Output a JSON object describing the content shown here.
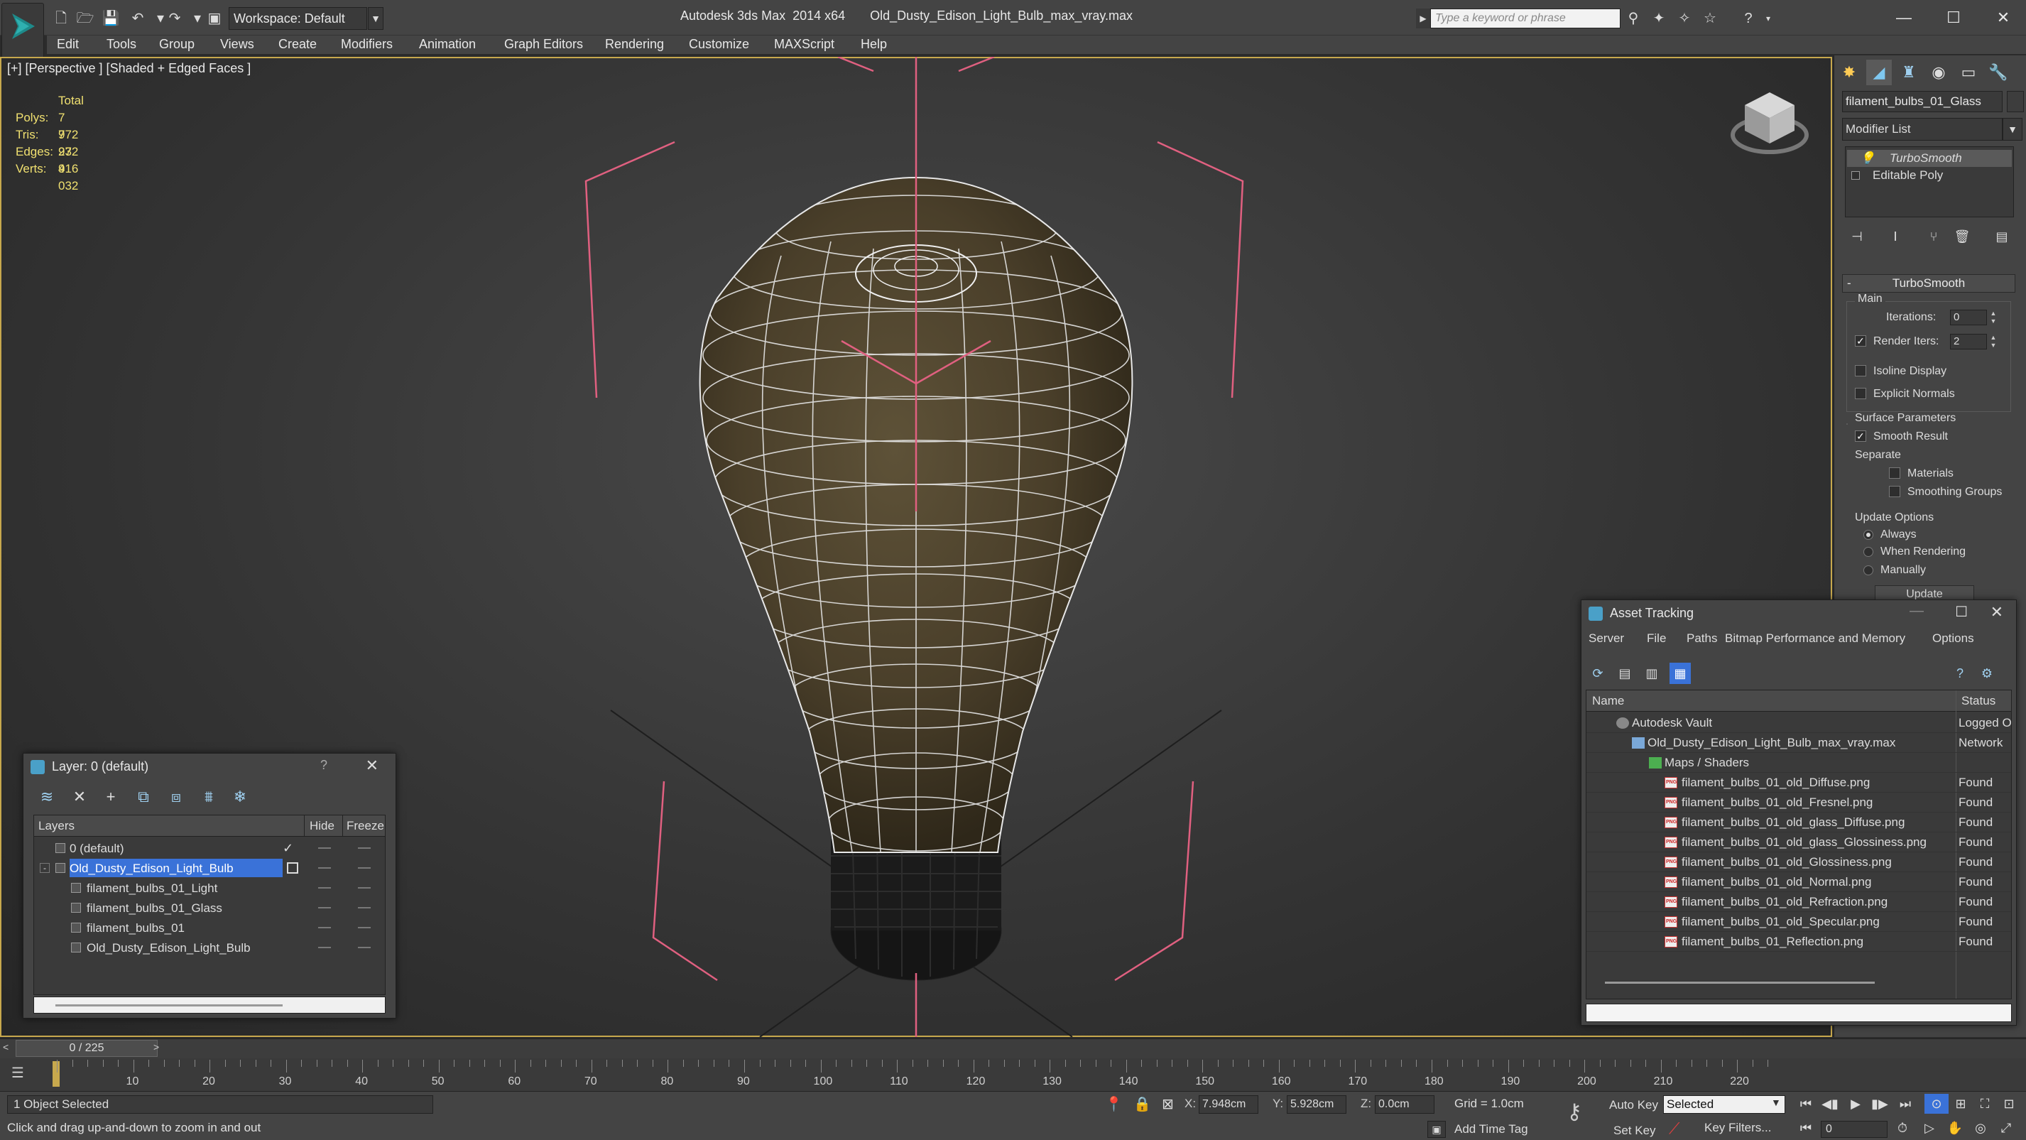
{
  "titlebar": {
    "workspace_label": "Workspace: Default",
    "title": "Autodesk 3ds Max  2014 x64       Old_Dusty_Edison_Light_Bulb_max_vray.max",
    "search_placeholder": "Type a keyword or phrase"
  },
  "menu": [
    "Edit",
    "Tools",
    "Group",
    "Views",
    "Create",
    "Modifiers",
    "Animation",
    "Graph Editors",
    "Rendering",
    "Customize",
    "MAXScript",
    "Help"
  ],
  "viewport": {
    "label": "[+] [Perspective ] [Shaded + Edged Faces ]",
    "stats_header": "Total",
    "stats": [
      {
        "label": "Polys:",
        "value": "7 972"
      },
      {
        "label": "Tris:",
        "value": "7 972"
      },
      {
        "label": "Edges:",
        "value": "23 916"
      },
      {
        "label": "Verts:",
        "value": "4 032"
      }
    ]
  },
  "command_panel": {
    "object_name": "filament_bulbs_01_Glass",
    "modifier_list": "Modifier List",
    "stack": [
      "TurboSmooth",
      "Editable Poly"
    ],
    "rollout_title": "TurboSmooth",
    "main_label": "Main",
    "iterations_label": "Iterations:",
    "iterations_value": "0",
    "render_iters_label": "Render Iters:",
    "render_iters_value": "2",
    "isoline_label": "Isoline Display",
    "explicit_normals_label": "Explicit Normals",
    "surface_params_label": "Surface Parameters",
    "smooth_result_label": "Smooth Result",
    "separate_label": "Separate",
    "materials_label": "Materials",
    "smoothing_groups_label": "Smoothing Groups",
    "update_options_label": "Update Options",
    "always_label": "Always",
    "when_rendering_label": "When Rendering",
    "manually_label": "Manually",
    "update_button": "Update"
  },
  "layer_dialog": {
    "title": "Layer: 0 (default)",
    "help": "?",
    "columns": {
      "layers": "Layers",
      "hide": "Hide",
      "freeze": "Freeze"
    },
    "rows": [
      {
        "name": "0 (default)",
        "level": 0
      },
      {
        "name": "Old_Dusty_Edison_Light_Bulb",
        "level": 0
      },
      {
        "name": "filament_bulbs_01_Light",
        "level": 1
      },
      {
        "name": "filament_bulbs_01_Glass",
        "level": 1
      },
      {
        "name": "filament_bulbs_01",
        "level": 1
      },
      {
        "name": "Old_Dusty_Edison_Light_Bulb",
        "level": 1
      }
    ]
  },
  "asset_dialog": {
    "title": "Asset Tracking",
    "menu": [
      "Server",
      "File",
      "Paths",
      "Bitmap Performance and Memory",
      "Options"
    ],
    "columns": {
      "name": "Name",
      "status": "Status"
    },
    "rows": [
      {
        "name": "Autodesk Vault",
        "status": "Logged O",
        "level": 1,
        "icon": "vault"
      },
      {
        "name": "Old_Dusty_Edison_Light_Bulb_max_vray.max",
        "status": "Network",
        "level": 2,
        "icon": "file"
      },
      {
        "name": "Maps / Shaders",
        "status": "",
        "level": 3,
        "icon": "maps"
      },
      {
        "name": "filament_bulbs_01_old_Diffuse.png",
        "status": "Found",
        "level": 4,
        "icon": "png"
      },
      {
        "name": "filament_bulbs_01_old_Fresnel.png",
        "status": "Found",
        "level": 4,
        "icon": "png"
      },
      {
        "name": "filament_bulbs_01_old_glass_Diffuse.png",
        "status": "Found",
        "level": 4,
        "icon": "png"
      },
      {
        "name": "filament_bulbs_01_old_glass_Glossiness.png",
        "status": "Found",
        "level": 4,
        "icon": "png"
      },
      {
        "name": "filament_bulbs_01_old_Glossiness.png",
        "status": "Found",
        "level": 4,
        "icon": "png"
      },
      {
        "name": "filament_bulbs_01_old_Normal.png",
        "status": "Found",
        "level": 4,
        "icon": "png"
      },
      {
        "name": "filament_bulbs_01_old_Refraction.png",
        "status": "Found",
        "level": 4,
        "icon": "png"
      },
      {
        "name": "filament_bulbs_01_old_Specular.png",
        "status": "Found",
        "level": 4,
        "icon": "png"
      },
      {
        "name": "filament_bulbs_01_Reflection.png",
        "status": "Found",
        "level": 4,
        "icon": "png"
      }
    ]
  },
  "timeline": {
    "frame_readout": "0 / 225",
    "ticks": [
      10,
      20,
      30,
      40,
      50,
      60,
      70,
      80,
      90,
      100,
      110,
      120,
      130,
      140,
      150,
      160,
      170,
      180,
      190,
      200,
      210,
      220
    ],
    "max_frame": 225
  },
  "status": {
    "selection": "1 Object Selected",
    "prompt": "Click and drag up-and-down to zoom in and out",
    "x_label": "X:",
    "x_value": "7.948cm",
    "y_label": "Y:",
    "y_value": "5.928cm",
    "z_label": "Z:",
    "z_value": "0.0cm",
    "grid": "Grid = 1.0cm",
    "add_time_tag": "Add Time Tag",
    "auto_key": "Auto Key",
    "set_key": "Set Key",
    "selected_dropdown": "Selected",
    "key_filters": "Key Filters...",
    "current_frame": "0"
  },
  "colors": {
    "accent_yellow": "#c7a84d",
    "selection_blue": "#3a72d8",
    "stats_yellow": "#f0e070",
    "gizmo_pink": "#e06080"
  }
}
